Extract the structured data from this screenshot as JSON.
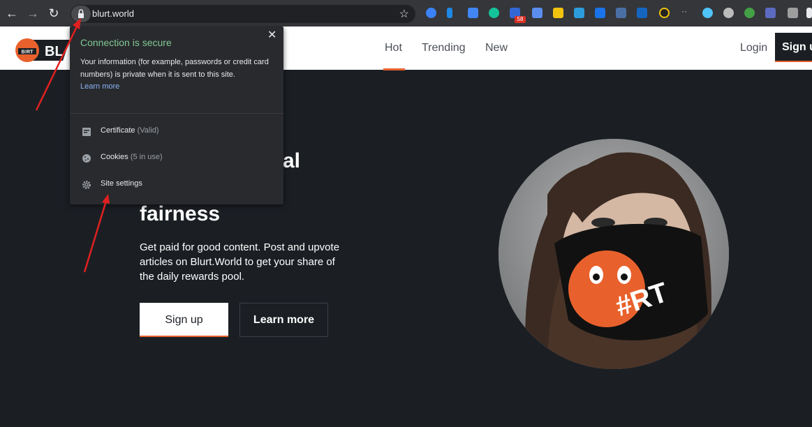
{
  "browser": {
    "url": "blurt.world",
    "ext_badge": "58"
  },
  "site": {
    "nav": [
      "Hot",
      "Trending",
      "New"
    ],
    "login": "Login",
    "signup_top": "Sign up",
    "hero_heading_partial": "al",
    "hero_heading": "fairness",
    "hero_text": "Get paid for good content. Post and upvote articles on Blurt.World to get your share of the daily rewards pool.",
    "btn_signup": "Sign up",
    "btn_learn": "Learn more",
    "logo_text": "B!RT",
    "mask_text": "#RT"
  },
  "popup": {
    "title": "Connection is secure",
    "description": "Your information (for example, passwords or credit card numbers) is private when it is sent to this site.",
    "learn_more": "Learn more",
    "certificate": "Certificate",
    "certificate_sub": "(Valid)",
    "cookies": "Cookies",
    "cookies_sub": "(5 in use)",
    "site_settings": "Site settings"
  },
  "colors": {
    "accent": "#e8612c",
    "secure_green": "#81c995",
    "link_blue": "#8ab4f8",
    "background": "#1b1f24",
    "annotation_red": "#e02020"
  }
}
